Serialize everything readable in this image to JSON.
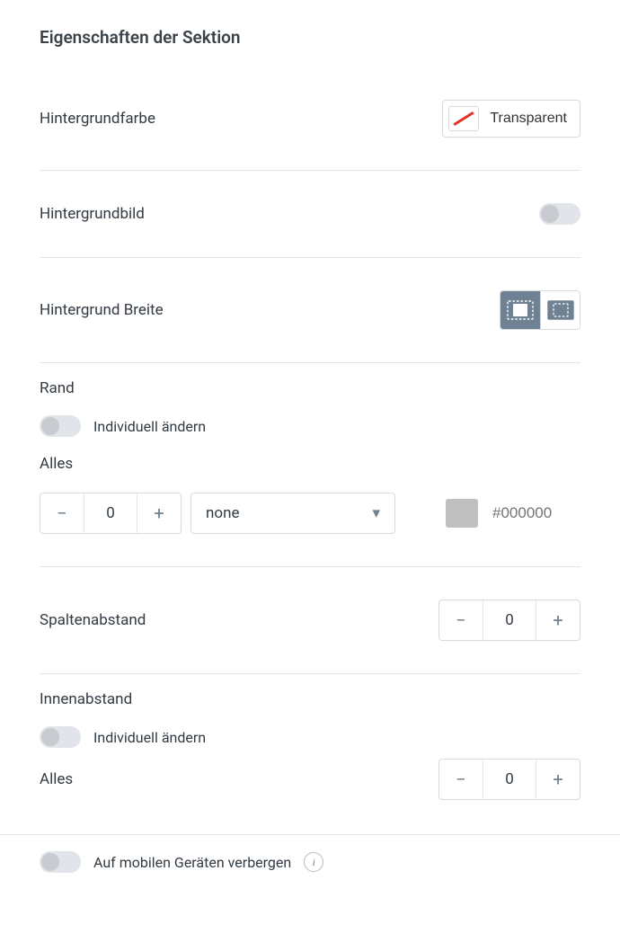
{
  "title": "Eigenschaften der Sektion",
  "bgcolor": {
    "label": "Hintergrundfarbe",
    "value_label": "Transparent"
  },
  "bgimage": {
    "label": "Hintergrundbild",
    "enabled": false
  },
  "bgwidth": {
    "label": "Hintergrund Breite",
    "selected_index": 0
  },
  "border": {
    "label": "Rand",
    "individual_label": "Individuell ändern",
    "all_label": "Alles",
    "value": "0",
    "style": "none",
    "color_placeholder": "#000000"
  },
  "colgap": {
    "label": "Spaltenabstand",
    "value": "0"
  },
  "padding": {
    "label": "Innenabstand",
    "individual_label": "Individuell ändern",
    "all_label": "Alles",
    "value": "0"
  },
  "hide_mobile": {
    "label": "Auf mobilen Geräten verbergen"
  },
  "glyphs": {
    "minus": "−",
    "plus": "+",
    "caret": "▾",
    "info": "i"
  }
}
